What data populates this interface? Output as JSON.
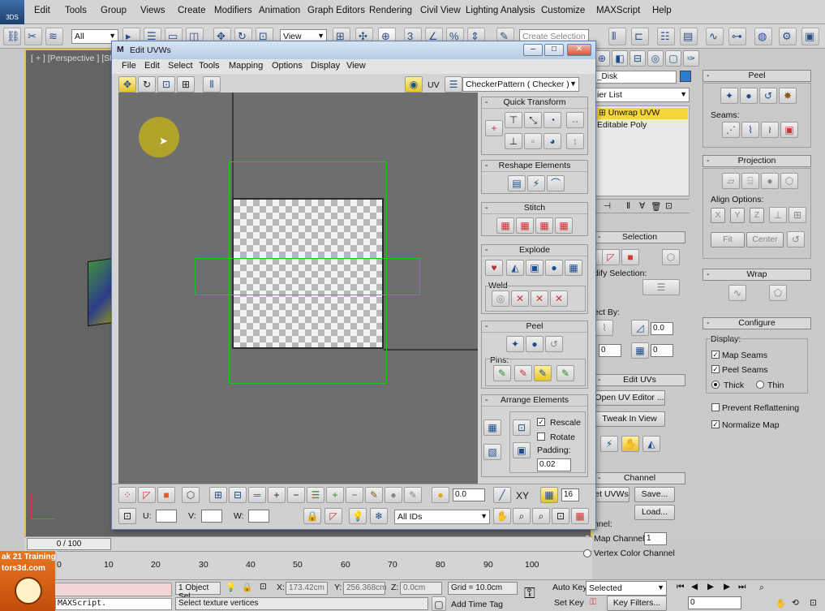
{
  "app": {
    "logo_text": "3DS",
    "menu": [
      "Edit",
      "Tools",
      "Group",
      "Views",
      "Create",
      "Modifiers",
      "Animation",
      "Graph Editors",
      "Rendering",
      "Civil View",
      "Lighting Analysis",
      "Customize",
      "MAXScript",
      "Help"
    ],
    "selection_filter": "All",
    "ref_coord": "View",
    "named_selection_placeholder": "Create Selection Se"
  },
  "viewport": {
    "label": "[ + ] [Perspective ] [Shac"
  },
  "dialog": {
    "title": "Edit UVWs",
    "menu": [
      "File",
      "Edit",
      "Select",
      "Tools",
      "Mapping",
      "Options",
      "Display",
      "View"
    ],
    "uv_label": "UV",
    "map_dropdown": "CheckerPattern  ( Checker )",
    "side": {
      "quick_transform": "Quick Transform",
      "reshape": "Reshape Elements",
      "stitch": "Stitch",
      "explode": "Explode",
      "weld": "Weld",
      "peel": "Peel",
      "pins": "Pins:",
      "arrange": "Arrange Elements",
      "rescale": "Rescale",
      "rotate": "Rotate",
      "padding_label": "Padding:",
      "padding_value": "0.02"
    },
    "bottom": {
      "spin_value": "0.0",
      "xy_label": "XY",
      "grid_value": "16",
      "u_label": "U:",
      "v_label": "V:",
      "w_label": "W:",
      "ids_dropdown": "All IDs"
    }
  },
  "cmd": {
    "object_name": "_Disk",
    "modifier_list": "ier List",
    "stack": [
      "Unwrap UVW",
      "Editable Poly"
    ],
    "peel_head": "Peel",
    "seams_label": "Seams:",
    "projection_head": "Projection",
    "align_options": "Align Options:",
    "align_x": "X",
    "align_y": "Y",
    "align_z": "Z",
    "fit": "Fit",
    "center": "Center",
    "wrap_head": "Wrap",
    "configure_head": "Configure",
    "display_label": "Display:",
    "map_seams": "Map Seams",
    "peel_seams": "Peel Seams",
    "thick": "Thick",
    "thin": "Thin",
    "prevent_reflattening": "Prevent Reflattening",
    "normalize_map": "Normalize Map",
    "selection_head": "Selection",
    "modify_selection": "dify Selection:",
    "select_by": "ect By:",
    "select_by_v1": "0.0",
    "select_by_v2": "0",
    "select_by_v3": "0",
    "edit_uvs_head": "Edit UVs",
    "open_uv_editor": "Open UV Editor ...",
    "tweak_in_view": "Tweak In View",
    "channel_head": "Channel",
    "set_uvws": "et UVWs",
    "save": "Save...",
    "load": "Load...",
    "channel_label": "nnel:",
    "map_channel": "Map Channel:",
    "map_channel_value": "1",
    "vertex_color_channel": "Vertex Color Channel"
  },
  "timeline": {
    "frame": "0 / 100",
    "ticks": [
      "0",
      "10",
      "20",
      "30",
      "40",
      "50",
      "60",
      "70",
      "80",
      "90",
      "100"
    ]
  },
  "status": {
    "brand_line1": "ak 21 Training",
    "brand_line2": "tors3d.com",
    "objects_selected": "1 Object Sel",
    "x_label": "X:",
    "x_value": "173.42cm",
    "y_label": "Y:",
    "y_value": "256.368cm",
    "z_label": "Z:",
    "z_value": "0.0cm",
    "grid": "Grid = 10.0cm",
    "auto_key": "Auto Key",
    "set_key": "Set Key",
    "selected_dropdown": "Selected",
    "key_filters": "Key Filters...",
    "add_time_tag": "Add Time Tag",
    "prompt": "Select texture vertices",
    "maxscript": "MAXScript.",
    "frame_value": "0"
  },
  "colors": {
    "accent_yellow": "#e6c04a",
    "selection_green": "#1fc21f",
    "title_blue": "#b7cbe6"
  }
}
